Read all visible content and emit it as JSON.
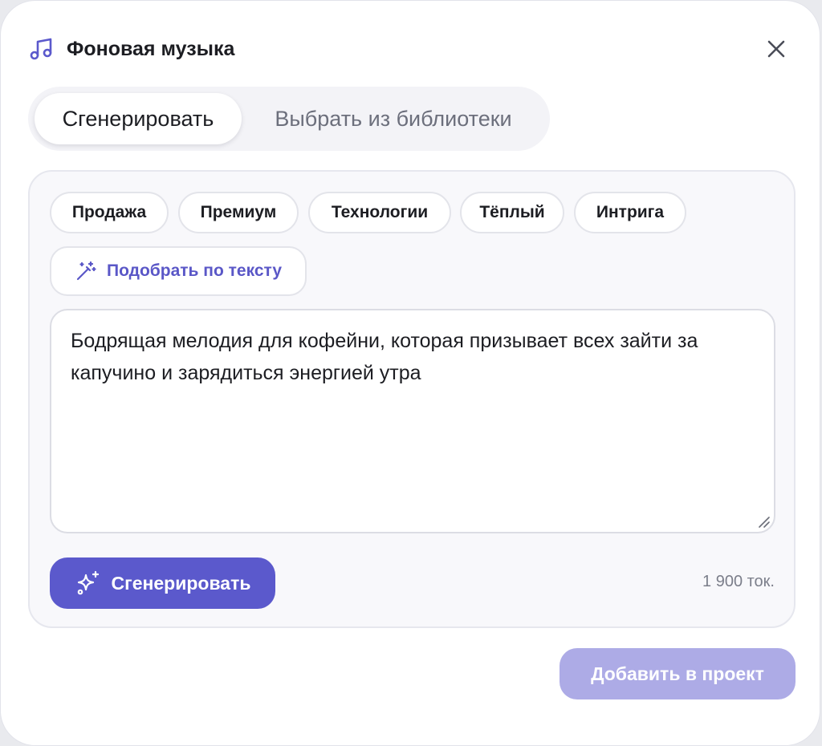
{
  "dialog": {
    "title": "Фоновая музыка",
    "icon": "music-note-icon",
    "close_icon": "close-icon"
  },
  "tabs": [
    {
      "label": "Сгенерировать",
      "active": true
    },
    {
      "label": "Выбрать из библиотеки",
      "active": false
    }
  ],
  "chips": [
    {
      "label": "Продажа"
    },
    {
      "label": "Премиум"
    },
    {
      "label": "Технологии"
    },
    {
      "label": "Тёплый"
    },
    {
      "label": "Интрига"
    }
  ],
  "match_button": {
    "label": "Подобрать по тексту",
    "icon": "magic-wand-icon"
  },
  "prompt": {
    "value": "Бодрящая мелодия для кофейни, которая призывает всех зайти за капучино и зарядиться энергией утра"
  },
  "generate_button": {
    "label": "Сгенерировать",
    "icon": "sparkles-icon"
  },
  "cost": "1 900 ток.",
  "add_button": {
    "label": "Добавить в проект",
    "disabled": true
  },
  "colors": {
    "accent": "#5b59cc",
    "accent_disabled": "#adabe6",
    "accent_text": "#5a57c7",
    "panel_bg": "#f8f8fb",
    "text": "#1c1d22",
    "muted": "#7b7e8a"
  }
}
